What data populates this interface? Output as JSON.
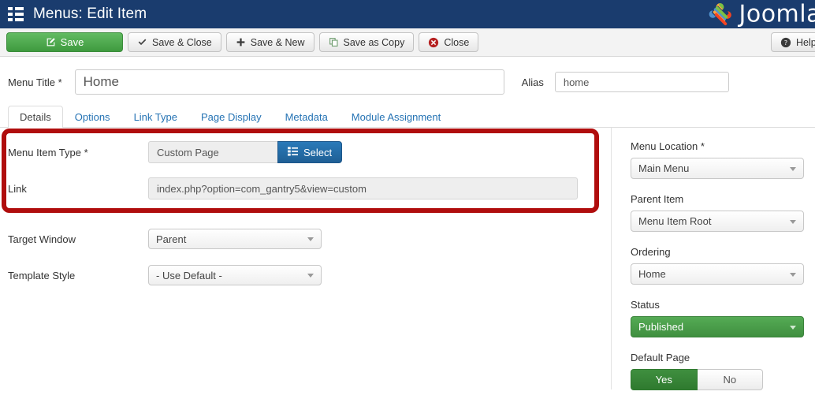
{
  "header": {
    "title": "Menus: Edit Item",
    "menu_icon": "list-grid-icon",
    "brand": "Joomla",
    "brand_icon": "joomla-logo-icon",
    "bg_color": "#1a3c6e"
  },
  "toolbar": {
    "buttons": [
      {
        "label": "Save",
        "icon": "edit-pencil-icon",
        "style": "primary-green"
      },
      {
        "label": "Save & Close",
        "icon": "check-icon",
        "style": "default"
      },
      {
        "label": "Save & New",
        "icon": "plus-icon",
        "style": "default"
      },
      {
        "label": "Save as Copy",
        "icon": "copy-icon",
        "style": "default"
      },
      {
        "label": "Close",
        "icon": "close-circle-icon",
        "style": "default"
      }
    ],
    "help": {
      "label": "Help",
      "icon": "help-circle-icon"
    }
  },
  "form": {
    "menu_title_label": "Menu Title *",
    "menu_title_value": "Home",
    "alias_label": "Alias",
    "alias_value": "home"
  },
  "tabs": [
    {
      "label": "Details",
      "active": true
    },
    {
      "label": "Options",
      "active": false
    },
    {
      "label": "Link Type",
      "active": false
    },
    {
      "label": "Page Display",
      "active": false
    },
    {
      "label": "Metadata",
      "active": false
    },
    {
      "label": "Module Assignment",
      "active": false
    }
  ],
  "main": {
    "menu_item_type_label": "Menu Item Type *",
    "menu_item_type_value": "Custom Page",
    "select_button_label": "Select",
    "select_button_icon": "list-grid-icon",
    "link_label": "Link",
    "link_value": "index.php?option=com_gantry5&view=custom",
    "target_window_label": "Target Window",
    "target_window_value": "Parent",
    "template_style_label": "Template Style",
    "template_style_value": "- Use Default -"
  },
  "highlight": {
    "color": "#b00d0d",
    "description": "red annotation box around Menu Item Type and Link"
  },
  "sidebar": {
    "menu_location_label": "Menu Location *",
    "menu_location_value": "Main Menu",
    "parent_item_label": "Parent Item",
    "parent_item_value": "Menu Item Root",
    "ordering_label": "Ordering",
    "ordering_value": "Home",
    "status_label": "Status",
    "status_value": "Published",
    "status_color": "#3f8f3f",
    "default_page_label": "Default Page",
    "default_page_yes": "Yes",
    "default_page_no": "No",
    "default_page_selected": "Yes"
  }
}
